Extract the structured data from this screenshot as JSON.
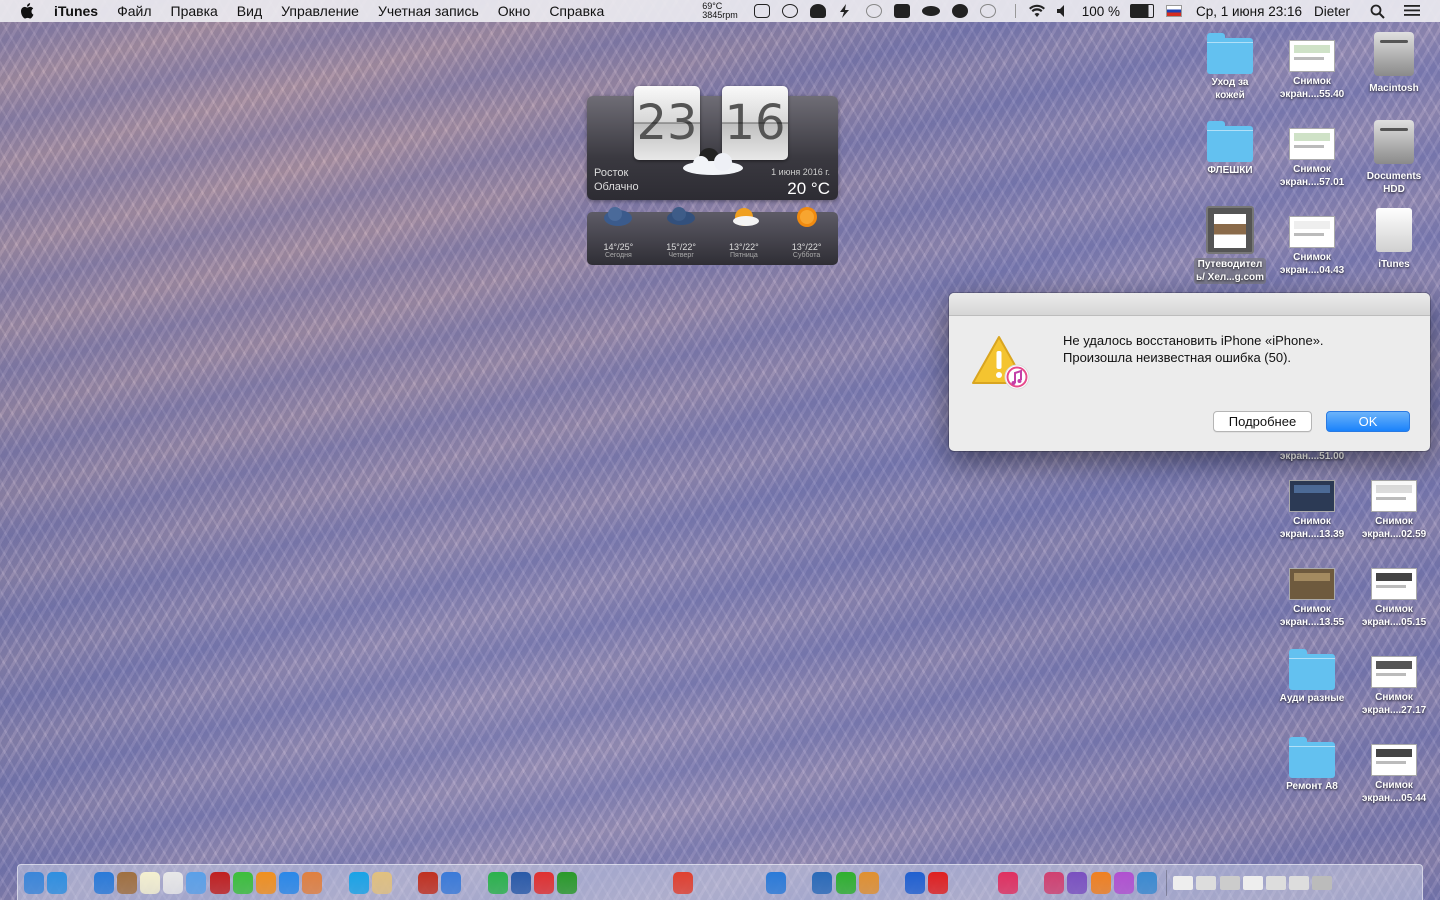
{
  "menubar": {
    "app": "iTunes",
    "items": [
      "Файл",
      "Правка",
      "Вид",
      "Управление",
      "Учетная запись",
      "Окно",
      "Справка"
    ],
    "temp_line1": "69°C",
    "temp_line2": "3845rpm",
    "battery": "100 %",
    "datetime": "Ср, 1 июня 23:16",
    "user": "Dieter"
  },
  "widget": {
    "hours": "23",
    "minutes": "16",
    "city": "Росток",
    "condition": "Облачно",
    "date": "1 июня 2016 г.",
    "temp": "20 °C",
    "forecast": [
      {
        "temps": "14°/25°",
        "day": "Сегодня"
      },
      {
        "temps": "15°/22°",
        "day": "Четверг"
      },
      {
        "temps": "13°/22°",
        "day": "Пятница"
      },
      {
        "temps": "13°/22°",
        "day": "Суббота"
      }
    ]
  },
  "desktop": {
    "icons": [
      {
        "id": "i1",
        "label1": "Уход за",
        "label2": "кожей",
        "kind": "folder"
      },
      {
        "id": "i2",
        "label1": "Снимок",
        "label2": "экран....55.40",
        "kind": "shot"
      },
      {
        "id": "i3",
        "label1": "Macintosh",
        "label2": "",
        "kind": "hdd"
      },
      {
        "id": "i4",
        "label1": "ФЛЕШКИ",
        "label2": "",
        "kind": "folder"
      },
      {
        "id": "i5",
        "label1": "Снимок",
        "label2": "экран....57.01",
        "kind": "shot"
      },
      {
        "id": "i6",
        "label1": "Documents",
        "label2": "HDD",
        "kind": "hdd"
      },
      {
        "id": "i7",
        "label1": "Путеводител",
        "label2": "ь/ Хел...g.com",
        "kind": "book"
      },
      {
        "id": "i8",
        "label1": "Снимок",
        "label2": "экран....04.43",
        "kind": "shot"
      },
      {
        "id": "i9",
        "label1": "iTunes",
        "label2": "",
        "kind": "white"
      },
      {
        "id": "i10",
        "label1": "",
        "label2": "экран....51.00",
        "kind": "none"
      },
      {
        "id": "i11",
        "label1": "Снимок",
        "label2": "экран....13.39",
        "kind": "shot-dark"
      },
      {
        "id": "i12",
        "label1": "Снимок",
        "label2": "экран....02.59",
        "kind": "shot"
      },
      {
        "id": "i13",
        "label1": "Снимок",
        "label2": "экран....13.55",
        "kind": "shot-brown"
      },
      {
        "id": "i14",
        "label1": "Снимок",
        "label2": "экран....05.15",
        "kind": "shot"
      },
      {
        "id": "i15",
        "label1": "Ауди разные",
        "label2": "",
        "kind": "folder"
      },
      {
        "id": "i16",
        "label1": "Снимок",
        "label2": "экран....27.17",
        "kind": "shot"
      },
      {
        "id": "i17",
        "label1": "Ремонт A8",
        "label2": "",
        "kind": "folder"
      },
      {
        "id": "i18",
        "label1": "Снимок",
        "label2": "экран....05.44",
        "kind": "shot"
      }
    ]
  },
  "dialog": {
    "line1": "Не удалось восстановить iPhone «iPhone».",
    "line2": "Произошла неизвестная ошибка (50).",
    "more_button": "Подробнее",
    "ok_button": "OK"
  },
  "dock": {
    "colors": [
      "#3b86d9",
      "#2f8fe0",
      "#9aa",
      "#2a7ad8",
      "#a07040",
      "#f4f0d0",
      "#e8e8e8",
      "#5aa0e8",
      "#c02020",
      "#3cbf3c",
      "#f09020",
      "#2a88e8",
      "#e08040",
      "#999",
      "#1aa3e6",
      "#e0c080",
      "#ccc",
      "#c03020",
      "#3a7ad8",
      "#4a3",
      "#2bb24c",
      "#2a5aa8",
      "#e03030",
      "#2a9a2a",
      "#2ab",
      "#4a8",
      "#888",
      "#999",
      "#e04030",
      "#ccc",
      "#444",
      "#ddd",
      "#2a7ad8",
      "#333",
      "#2a6ab8",
      "#2fb02f",
      "#e09030",
      "#aaa",
      "#2060d0",
      "#e02020",
      "#555",
      "#4a4",
      "#e03060",
      "#ddd",
      "#d04070",
      "#7a50c0",
      "#f08020",
      "#b050d0",
      "#3a8ad0"
    ],
    "extra": [
      "#eee",
      "#ddd",
      "#ccc",
      "#eee",
      "#ddd",
      "#ddd",
      "#bbb"
    ]
  }
}
